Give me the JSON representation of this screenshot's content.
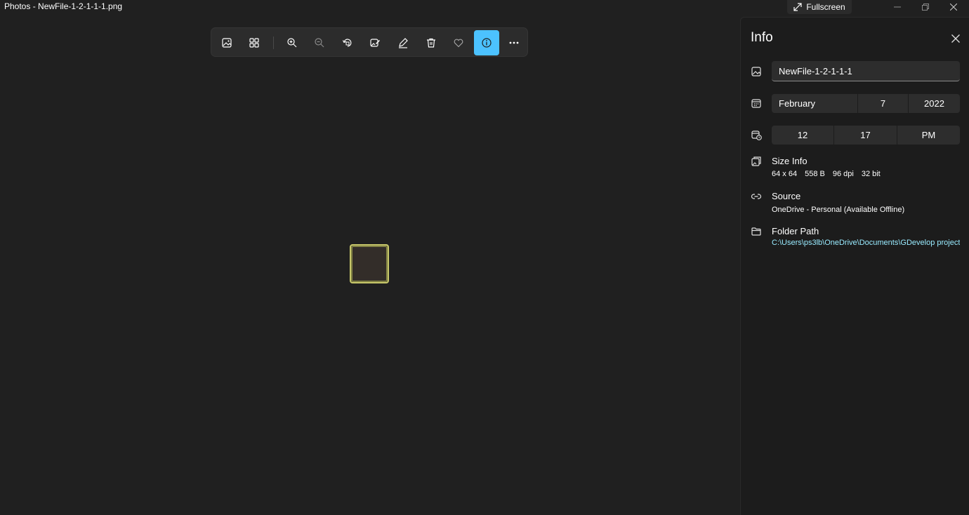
{
  "window": {
    "title": "Photos - NewFile-1-2-1-1-1.png",
    "fullscreen_label": "Fullscreen"
  },
  "toolbar": {
    "buttons": [
      {
        "name": "view-image",
        "icon": "image-icon"
      },
      {
        "name": "gallery",
        "icon": "gallery-grid-icon"
      },
      {
        "name": "zoom-in",
        "icon": "zoom-in-icon"
      },
      {
        "name": "zoom-out",
        "icon": "zoom-out-icon"
      },
      {
        "name": "rotate",
        "icon": "rotate-icon"
      },
      {
        "name": "edit-image",
        "icon": "edit-image-icon"
      },
      {
        "name": "draw",
        "icon": "pen-icon"
      },
      {
        "name": "delete",
        "icon": "trash-icon"
      },
      {
        "name": "favorite",
        "icon": "heart-icon"
      },
      {
        "name": "info",
        "icon": "info-icon",
        "active": true
      },
      {
        "name": "more",
        "icon": "more-icon"
      }
    ],
    "accent": "#4cc2ff"
  },
  "info_panel": {
    "title": "Info",
    "file_name": "NewFile-1-2-1-1-1",
    "date": {
      "month": "February",
      "day": "7",
      "year": "2022"
    },
    "time": {
      "hour": "12",
      "minute": "17",
      "period": "PM"
    },
    "size_info": {
      "label": "Size Info",
      "dimensions": "64 x 64",
      "file_size": "558 B",
      "dpi": "96 dpi",
      "bit_depth": "32 bit"
    },
    "source": {
      "label": "Source",
      "value": "OneDrive - Personal (Available Offline)"
    },
    "folder_path": {
      "label": "Folder Path",
      "value": "C:\\Users\\ps3lb\\OneDrive\\Documents\\GDevelop project"
    },
    "link_color": "#99ebff"
  }
}
